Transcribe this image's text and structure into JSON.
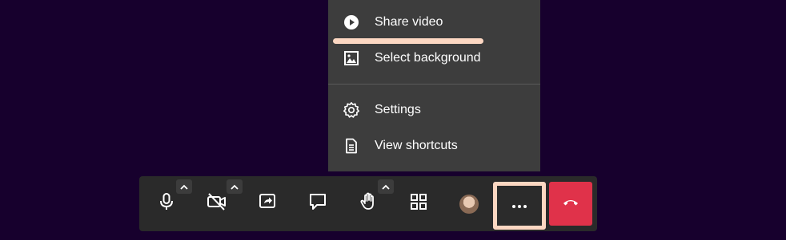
{
  "menu": {
    "items": [
      {
        "label": "Share video",
        "icon": "play-circle-icon"
      },
      {
        "label": "Select background",
        "icon": "image-icon"
      },
      {
        "label": "Settings",
        "icon": "gear-icon"
      },
      {
        "label": "View shortcuts",
        "icon": "document-icon"
      }
    ]
  },
  "toolbar": {
    "buttons": [
      {
        "icon": "microphone-icon",
        "has_caret": true
      },
      {
        "icon": "camera-off-icon",
        "has_caret": true
      },
      {
        "icon": "share-screen-icon",
        "has_caret": false
      },
      {
        "icon": "chat-icon",
        "has_caret": false
      },
      {
        "icon": "raise-hand-icon",
        "has_caret": true
      },
      {
        "icon": "tile-view-icon",
        "has_caret": false
      },
      {
        "icon": "avatar",
        "has_caret": false
      },
      {
        "icon": "more-options-icon",
        "has_caret": false
      },
      {
        "icon": "hang-up-icon",
        "has_caret": false
      }
    ]
  },
  "colors": {
    "background": "#17002d",
    "menu_bg": "#3d3d3d",
    "toolbar_bg": "#2a2a2a",
    "highlight": "#fcd7c2",
    "hangup": "#e0324a"
  }
}
